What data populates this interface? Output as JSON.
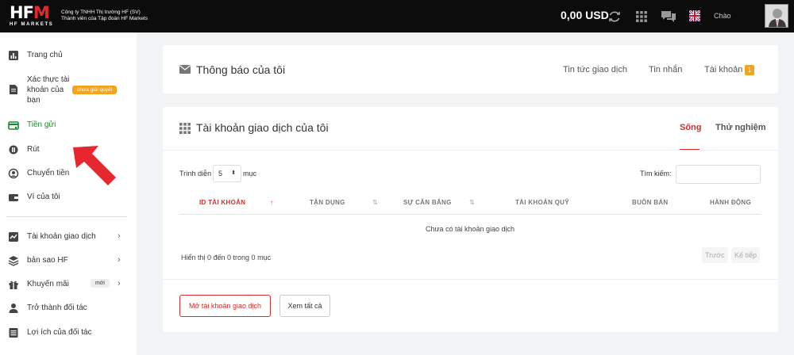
{
  "topbar": {
    "logo_text_a": "HF",
    "logo_text_b": "M",
    "logo_sub": "HF MARKETS",
    "company_line1": "Công ty TNHH Thị trường HF (SV)",
    "company_line2": "Thành viên của Tập đoàn HF Markets",
    "balance": "0,00 USD",
    "greeting": "Chào",
    "icons": [
      "refresh-icon",
      "apps-grid-icon",
      "chat-icon",
      "uk-flag-icon",
      "user-avatar"
    ]
  },
  "sidebar": {
    "items": [
      {
        "label": "Trang chủ",
        "icon": "dashboard-icon"
      },
      {
        "label": "Xác thực tài khoản của bạn",
        "line1": "Xác thực tài",
        "line2": "khoản của",
        "line3": "bạn",
        "icon": "document-icon",
        "badge": "chưa giải quyết"
      },
      {
        "label": "Tiền gửi",
        "icon": "deposit-icon",
        "active": true
      },
      {
        "label": "Rút",
        "icon": "withdraw-icon"
      },
      {
        "label": "Chuyển tiền",
        "icon": "transfer-icon"
      },
      {
        "label": "Ví của tôi",
        "icon": "wallet-icon"
      },
      {
        "label": "Tài khoản giao dịch",
        "icon": "chart-icon",
        "chevron": "›"
      },
      {
        "label": "bản sao HF",
        "icon": "layers-icon",
        "chevron": "›"
      },
      {
        "label": "Khuyến mãi",
        "icon": "gift-icon",
        "badge": "mới",
        "chevron": "›"
      },
      {
        "label": "Trở thành đối tác",
        "icon": "person-icon"
      },
      {
        "label": "Lợi ích của đối tác",
        "icon": "list-icon"
      }
    ]
  },
  "notifications": {
    "title": "Thông báo của tôi",
    "links": [
      "Tin tức giao dịch",
      "Tin nhắn",
      "Tài khoản"
    ],
    "account_count": "1"
  },
  "trading_accounts": {
    "title": "Tài khoản giao dịch của tôi",
    "tabs": [
      "Sống",
      "Thử nghiệm"
    ],
    "active_tab": "Sống",
    "show_label": "Trình diễn",
    "page_size": "5",
    "entries_label": "mục",
    "search_label": "Tìm kiếm:",
    "columns": [
      "ID TÀI KHOẢN",
      "TẬN DỤNG",
      "SỰ CÂN BẰNG",
      "TÀI KHOẢN QUỸ",
      "BUÔN BÁN",
      "HÀNH ĐỘNG"
    ],
    "empty_message": "Chưa có tài khoản giao dịch",
    "info": "Hiển thị 0 đến 0 trong 0 mục",
    "prev": "Trước",
    "next": "Kế tiếp",
    "open_button": "Mở tài khoản giao dịch",
    "view_all_button": "Xem tất cả"
  },
  "colors": {
    "accent_red": "#d32f2f",
    "active_green": "#1a8a2e",
    "badge_orange": "#f5a31a",
    "topbar": "#0c0c0c"
  }
}
